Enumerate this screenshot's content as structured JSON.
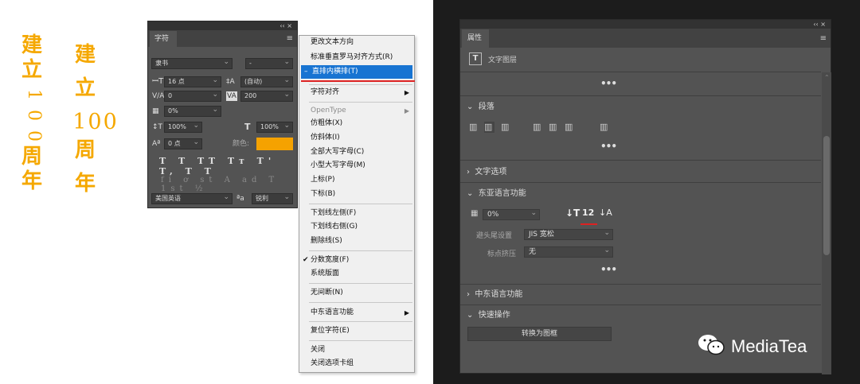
{
  "samples": {
    "vertical_chars": [
      "建",
      "立",
      "1",
      "0",
      "0",
      "周",
      "年"
    ],
    "tcy_chars": [
      "建",
      "立",
      "100",
      "周",
      "年"
    ]
  },
  "char_panel": {
    "title_arrows": "‹‹ ×",
    "tab": "字符",
    "font_family": "隶书",
    "font_style": "-",
    "font_size": "16 点",
    "leading": "(自动)",
    "kerning": "0",
    "tracking": "200",
    "tsume": "0%",
    "vscale": "100%",
    "hscale": "100%",
    "baseline": "0 点",
    "color_label": "颜色:",
    "color": "#f5a200",
    "style_icons": "T T TT Tт T' T, T T",
    "ot_icons": "fi ơ st A ad T 1st ½",
    "language": "美国英语",
    "aa_label": "ªa",
    "antialias": "锐利"
  },
  "menu": {
    "items": [
      {
        "label": "更改文本方向"
      },
      {
        "label": "标准垂直罗马对齐方式(R)"
      },
      {
        "label": "直排内横排(T)",
        "selected": true
      },
      {
        "label": "字符对齐",
        "arrow": true
      },
      {
        "label": "OpenType",
        "disabled": true,
        "arrow": true
      },
      {
        "label": "仿粗体(X)"
      },
      {
        "label": "仿斜体(I)"
      },
      {
        "label": "全部大写字母(C)"
      },
      {
        "label": "小型大写字母(M)"
      },
      {
        "label": "上标(P)"
      },
      {
        "label": "下标(B)"
      },
      {
        "label": "下划线左侧(F)"
      },
      {
        "label": "下划线右侧(G)"
      },
      {
        "label": "删除线(S)"
      },
      {
        "label": "分数宽度(F)",
        "checked": true
      },
      {
        "label": "系统版面"
      },
      {
        "label": "无间断(N)"
      },
      {
        "label": "中东语言功能",
        "arrow": true
      },
      {
        "label": "复位字符(E)"
      },
      {
        "label": "关闭"
      },
      {
        "label": "关闭选项卡组"
      }
    ],
    "check_glyph": "✔",
    "sel_glyph": "–",
    "arrow_glyph": "▶"
  },
  "props_panel": {
    "title_arrows": "‹‹ ×",
    "tab": "属性",
    "layer_icon": "T",
    "layer_label": "文字图层",
    "more": "•••",
    "paragraph": "段落",
    "text_options": "文字选项",
    "east_asian": "东亚语言功能",
    "tsume_value": "0%",
    "mojikumi_label": "避头尾设置",
    "mojikumi_value": "JIS 宽松",
    "kinsoku_label": "标点挤压",
    "kinsoku_value": "无",
    "middle_east": "中东语言功能",
    "quick_actions": "快速操作",
    "convert_btn": "转换为图框",
    "chevron_open": "⌄",
    "chevron_closed": "›"
  },
  "watermark": "MediaTea"
}
